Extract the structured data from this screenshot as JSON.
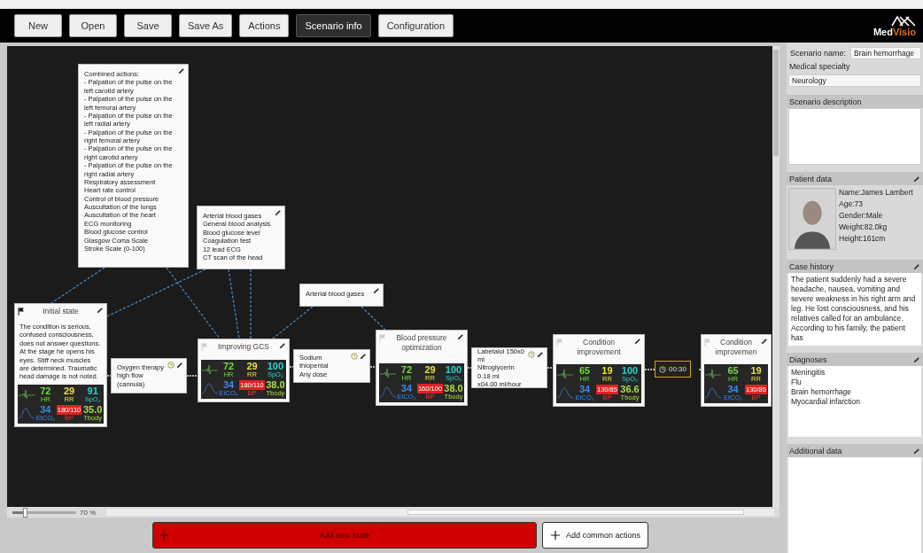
{
  "toolbar": {
    "buttons": [
      {
        "label": "New",
        "selected": false
      },
      {
        "label": "Open",
        "selected": false
      },
      {
        "label": "Save",
        "selected": false
      },
      {
        "label": "Save As",
        "selected": false
      },
      {
        "label": "Actions",
        "selected": false
      },
      {
        "label": "Scenario info",
        "selected": true
      },
      {
        "label": "Configuration",
        "selected": false
      }
    ]
  },
  "logo": {
    "text_main": "Med",
    "text_accent": "Visio"
  },
  "canvas": {
    "states": [
      {
        "title": "Initial state",
        "flag": true,
        "description": "The condition is serious, confused consciousness, does not answer questions. At the stage he opens his eyes. Stiff neck muscles are determined. Traumatic head damage is not noted.",
        "vitals": [
          {
            "kind": "hr",
            "value": "72",
            "label": "HR"
          },
          {
            "kind": "rr",
            "value": "29",
            "label": "RR"
          },
          {
            "kind": "spo2",
            "value": "91",
            "label": "SpO₂"
          },
          {
            "kind": "etco2",
            "value": "34",
            "label": "EtCO₂"
          },
          {
            "kind": "bp",
            "value": "180/110",
            "label": "BP"
          },
          {
            "kind": "temp",
            "value": "35.0",
            "label": "Tbody"
          }
        ]
      },
      {
        "title": "Improving GCS",
        "flag": false,
        "vitals": [
          {
            "kind": "hr",
            "value": "72",
            "label": "HR"
          },
          {
            "kind": "rr",
            "value": "29",
            "label": "RR"
          },
          {
            "kind": "spo2",
            "value": "100",
            "label": "SpO₂"
          },
          {
            "kind": "etco2",
            "value": "34",
            "label": "EtCO₂"
          },
          {
            "kind": "bp",
            "value": "180/110",
            "label": "BP"
          },
          {
            "kind": "temp",
            "value": "38.0",
            "label": "Tbody"
          }
        ]
      },
      {
        "title": "Blood pressure optimization",
        "flag": false,
        "vitals": [
          {
            "kind": "hr",
            "value": "72",
            "label": "HR"
          },
          {
            "kind": "rr",
            "value": "29",
            "label": "RR"
          },
          {
            "kind": "spo2",
            "value": "100",
            "label": "SpO₂"
          },
          {
            "kind": "etco2",
            "value": "34",
            "label": "EtCO₂"
          },
          {
            "kind": "bp",
            "value": "160/100",
            "label": "BP"
          },
          {
            "kind": "temp",
            "value": "38.0",
            "label": "Tbody"
          }
        ]
      },
      {
        "title": "Condition improvement",
        "flag": false,
        "vitals": [
          {
            "kind": "hr",
            "value": "65",
            "label": "HR"
          },
          {
            "kind": "rr",
            "value": "19",
            "label": "RR"
          },
          {
            "kind": "spo2",
            "value": "100",
            "label": "SpO₂"
          },
          {
            "kind": "etco2",
            "value": "34",
            "label": "EtCO₂"
          },
          {
            "kind": "bp",
            "value": "130/85",
            "label": "BP"
          },
          {
            "kind": "temp",
            "value": "36.6",
            "label": "Tbody"
          }
        ]
      },
      {
        "title": "Condition improvemen",
        "flag": false,
        "vitals": [
          {
            "kind": "hr",
            "value": "65",
            "label": "HR"
          },
          {
            "kind": "rr",
            "value": "19",
            "label": "RR"
          },
          {
            "kind": "etco2",
            "value": "34",
            "label": "EtCO₂"
          },
          {
            "kind": "bp",
            "value": "130/85",
            "label": "BP"
          }
        ]
      }
    ],
    "actions": [
      {
        "kind": "branch",
        "lines": [
          "Combined actions:",
          "- Palpation of the pulse on the left carotid artery",
          "- Palpation of the pulse on the left femoral artery",
          "- Palpation of the pulse on the left radial artery",
          "- Palpation of the pulse on the right femoral artery",
          "- Palpation of the pulse on the right carotid artery",
          "- Palpation of the pulse on the right radial artery",
          "Respiratory assessment",
          "Heart rate control",
          "Control of blood pressure",
          "Auscultation of the lungs",
          "Auscultation of the heart",
          "ECG monitoring",
          "Blood glucose control",
          "Glasgow Coma Scale",
          "Stroke Scale (0-100)"
        ]
      },
      {
        "kind": "branch",
        "lines": [
          "Arterial blood gases",
          "General blood analysis",
          "Blood glucose level",
          "Coagulation test",
          "12 lead ECG",
          "CT scan of the head"
        ]
      },
      {
        "kind": "branch",
        "lines": [
          "Arterial blood gases"
        ]
      },
      {
        "kind": "transition",
        "lines": [
          "Oxygen therapy high flow (cannula)"
        ]
      },
      {
        "kind": "transition",
        "lines": [
          "Sodium thiopental",
          "Any dose"
        ]
      },
      {
        "kind": "transition",
        "lines": [
          "Labetalol 150x0 ml",
          "Nitroglycerin 0.18 ml",
          "x04.00 ml/hour"
        ]
      }
    ],
    "timer": {
      "text": "00:30"
    }
  },
  "zoom": {
    "level": 0.2,
    "reading": "70 %"
  },
  "bottom_buttons": [
    {
      "kind": "primary",
      "label": "Add new state"
    },
    {
      "kind": "secondary",
      "label": "Add common actions"
    }
  ],
  "panel": {
    "scenario_name": {
      "label": "Scenario name:",
      "value": "Brain hemorrhage"
    },
    "medical_specialty": {
      "label": "Medical specialty",
      "value": "Neurology"
    },
    "scenario_description": {
      "label": "Scenario description"
    },
    "patient_data": {
      "title": "Patient data",
      "fields": [
        "Name:James Lambert",
        "Age:73",
        "Gender:Male",
        "Weight:82.0kg",
        "Height:161cm"
      ]
    },
    "case_history": {
      "title": "Case history",
      "text": "The patient  suddenly had a severe headache, nausea, vomiting and severe weakness in his right arm and leg. He lost consciousness, and his relatives called for an ambulance. According to his family, the patient has"
    },
    "diagnoses": {
      "title": "Diagnoses",
      "items": [
        "Meningitis",
        "Flu",
        "Brain hemorrhage",
        "Myocardial infarction"
      ]
    },
    "additional_data": {
      "title": "Additional data"
    }
  }
}
